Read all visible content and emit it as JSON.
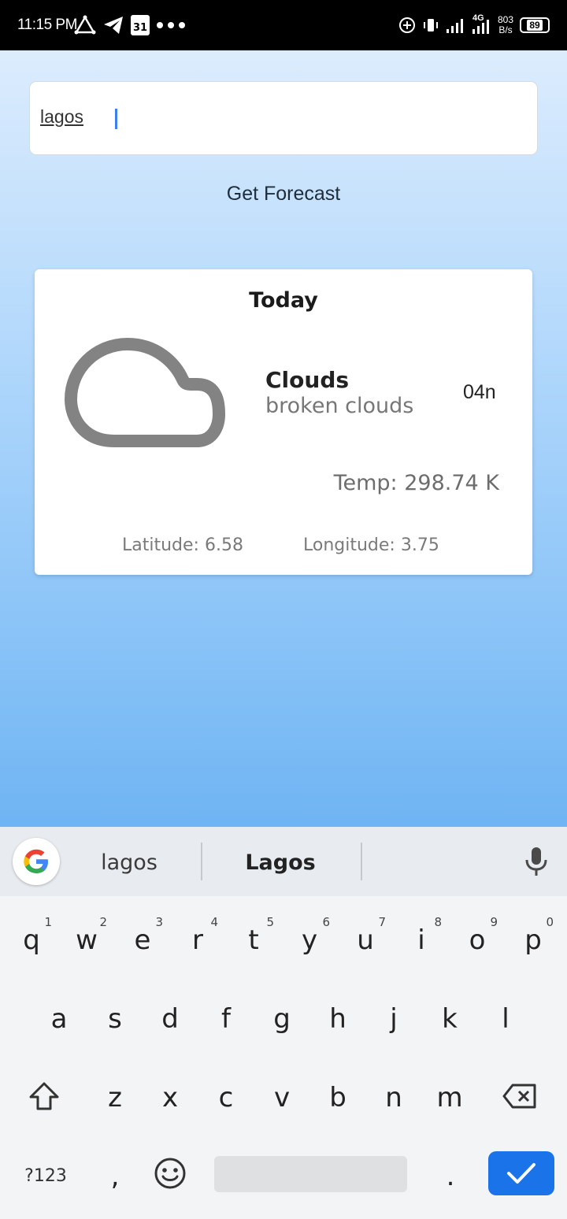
{
  "status_bar": {
    "time": "11:15 PM",
    "calendar_day": "31",
    "net_speed_value": "803",
    "net_speed_unit": "B/s",
    "network": "4G",
    "battery": "89"
  },
  "search": {
    "value": "lagos"
  },
  "forecast_button": {
    "label": "Get Forecast"
  },
  "card": {
    "title": "Today",
    "condition": "Clouds",
    "description": "broken clouds",
    "icon_code": "04n",
    "temperature": "Temp: 298.74 K",
    "latitude": "Latitude: 6.58",
    "longitude": "Longitude: 3.75",
    "icon": "cloud-icon"
  },
  "keyboard": {
    "suggestions": [
      "lagos",
      "Lagos"
    ],
    "row1": [
      {
        "key": "q",
        "hint": "1"
      },
      {
        "key": "w",
        "hint": "2"
      },
      {
        "key": "e",
        "hint": "3"
      },
      {
        "key": "r",
        "hint": "4"
      },
      {
        "key": "t",
        "hint": "5"
      },
      {
        "key": "y",
        "hint": "6"
      },
      {
        "key": "u",
        "hint": "7"
      },
      {
        "key": "i",
        "hint": "8"
      },
      {
        "key": "o",
        "hint": "9"
      },
      {
        "key": "p",
        "hint": "0"
      }
    ],
    "row2": [
      "a",
      "s",
      "d",
      "f",
      "g",
      "h",
      "j",
      "k",
      "l"
    ],
    "row3": [
      "z",
      "x",
      "c",
      "v",
      "b",
      "n",
      "m"
    ],
    "symbols_key": "?123",
    "comma_key": ",",
    "period_key": "."
  },
  "colors": {
    "accent": "#1a73e8",
    "card_text_muted": "#777777",
    "background_top": "#dcecfd",
    "background_bottom": "#6fb4f3"
  }
}
